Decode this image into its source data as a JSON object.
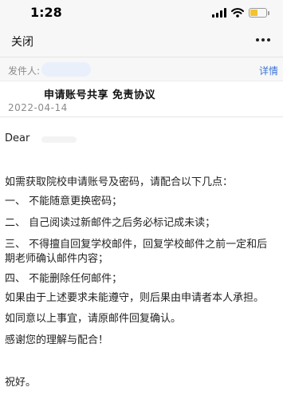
{
  "status_bar": {
    "time": "1:28",
    "battery_level": 0.45,
    "icons": [
      "signal-icon",
      "wifi-icon",
      "battery-icon"
    ]
  },
  "nav": {
    "close_label": "关闭",
    "more_icon": "more-dots-icon"
  },
  "header": {
    "sender_label": "发件人:",
    "details_label": "详情"
  },
  "email": {
    "subject": "申请账号共享 免责协议",
    "date": "2022-04-14",
    "salutation": "Dear",
    "intro": "如需获取院校申请账号及密码，请配合以下几点：",
    "items": [
      "一、  不能随意更换密码；",
      "二、  自己阅读过新邮件之后务必标记成未读；",
      "三、  不得擅自回复学校邮件，回复学校邮件之前一定和后",
      "四、  不能删除任何邮件；"
    ],
    "item3_continuation": "期老师确认邮件内容；",
    "consequence": "如果由于上述要求未能遵守，则后果由申请者本人承担。",
    "confirm": "如同意以上事宜，请原邮件回复确认。",
    "thanks": "感谢您的理解与配合！",
    "regards": "祝好。"
  },
  "colors": {
    "link": "#3b74d6",
    "battery": "#f2c231",
    "bar_background": "#f7f7f7"
  }
}
